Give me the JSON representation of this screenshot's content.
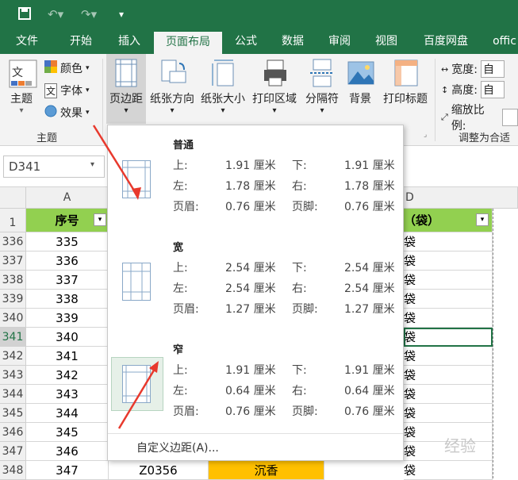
{
  "window": {
    "quick_access": [
      "save-icon",
      "undo-icon",
      "redo-icon",
      "customize-icon"
    ]
  },
  "tabs": [
    "文件",
    "开始",
    "插入",
    "页面布局",
    "公式",
    "数据",
    "审阅",
    "视图",
    "百度网盘",
    "offic"
  ],
  "ribbon": {
    "theme_label": "主题",
    "colors_label": "颜色",
    "fonts_label": "字体",
    "effects_label": "效果",
    "group_theme": "主题",
    "margins_label": "页边距",
    "orientation_label": "纸张方向",
    "size_label": "纸张大小",
    "print_area_label": "打印区域",
    "breaks_label": "分隔符",
    "background_label": "背景",
    "print_titles_label": "打印标题",
    "width_label": "宽度:",
    "width_value": "自",
    "height_label": "高度:",
    "height_value": "自",
    "scale_label": "缩放比例:",
    "group_scale": "调整为合适"
  },
  "formula_bar": {
    "name_box": "D341"
  },
  "columns": {
    "a": "A",
    "d": "D"
  },
  "header_row": {
    "num": "1",
    "a": "序号",
    "d": "（袋）"
  },
  "rows": [
    {
      "num": "336",
      "a": "335",
      "d": "袋"
    },
    {
      "num": "337",
      "a": "336",
      "d": "袋"
    },
    {
      "num": "338",
      "a": "337",
      "d": "袋"
    },
    {
      "num": "339",
      "a": "338",
      "d": "袋"
    },
    {
      "num": "340",
      "a": "339",
      "d": "袋"
    },
    {
      "num": "341",
      "a": "340",
      "d": "袋"
    },
    {
      "num": "342",
      "a": "341",
      "d": "袋"
    },
    {
      "num": "343",
      "a": "342",
      "d": "袋"
    },
    {
      "num": "344",
      "a": "343",
      "d": "袋"
    },
    {
      "num": "345",
      "a": "344",
      "d": "袋"
    },
    {
      "num": "346",
      "a": "345",
      "d": "袋"
    },
    {
      "num": "347",
      "a": "346",
      "d": "袋"
    },
    {
      "num": "348",
      "a": "347",
      "b": "Z0356",
      "c": "沉香",
      "d": "袋"
    }
  ],
  "margins_menu": {
    "options": [
      {
        "name": "普通",
        "top_label": "上:",
        "top": "1.91 厘米",
        "bottom_label": "下:",
        "bottom": "1.91 厘米",
        "left_label": "左:",
        "left": "1.78 厘米",
        "right_label": "右:",
        "right": "1.78 厘米",
        "header_label": "页眉:",
        "header": "0.76 厘米",
        "footer_label": "页脚:",
        "footer": "0.76 厘米"
      },
      {
        "name": "宽",
        "top_label": "上:",
        "top": "2.54 厘米",
        "bottom_label": "下:",
        "bottom": "2.54 厘米",
        "left_label": "左:",
        "left": "2.54 厘米",
        "right_label": "右:",
        "right": "2.54 厘米",
        "header_label": "页眉:",
        "header": "1.27 厘米",
        "footer_label": "页脚:",
        "footer": "1.27 厘米"
      },
      {
        "name": "窄",
        "top_label": "上:",
        "top": "1.91 厘米",
        "bottom_label": "下:",
        "bottom": "1.91 厘米",
        "left_label": "左:",
        "left": "0.64 厘米",
        "right_label": "右:",
        "right": "0.64 厘米",
        "header_label": "页眉:",
        "header": "0.76 厘米",
        "footer_label": "页脚:",
        "footer": "0.76 厘米"
      }
    ],
    "custom": "自定义边距(A)..."
  },
  "watermark": "经验",
  "colors": {
    "accent": "#217346",
    "header_fill": "#92d050",
    "highlight_fill": "#ffc000",
    "arrow": "#e8392d"
  }
}
